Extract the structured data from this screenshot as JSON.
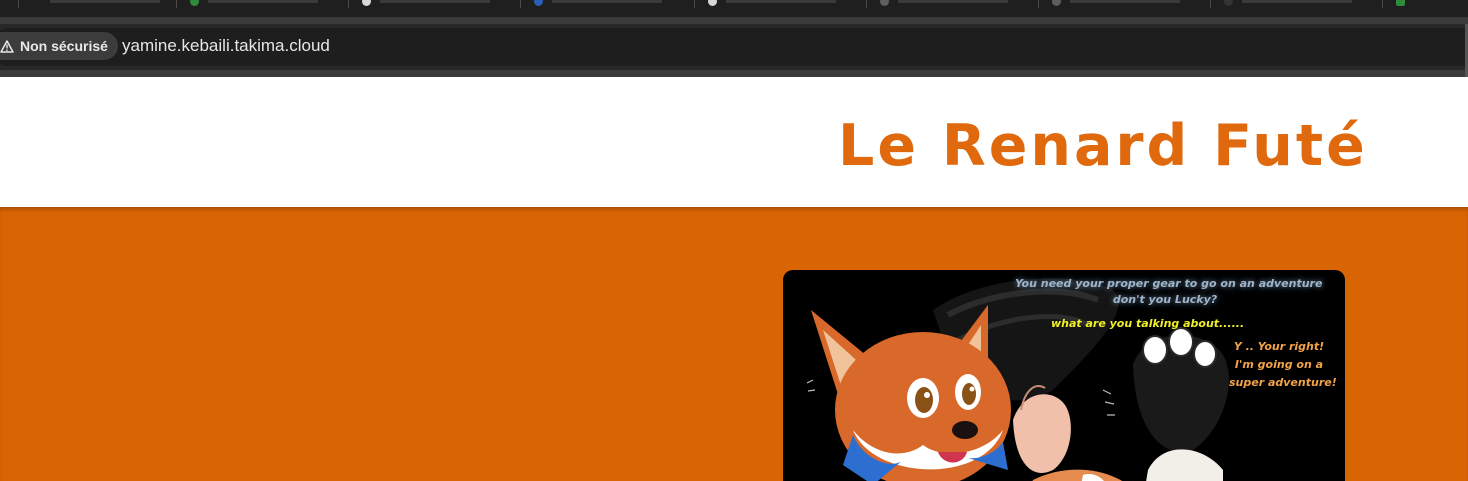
{
  "browser": {
    "security_label": "Non sécurisé",
    "url": "yamine.kebaili.takima.cloud"
  },
  "site": {
    "title": "Le Renard Futé"
  },
  "comic": {
    "line1": "You need your proper gear to go on an adventure",
    "line2": "don't you Lucky?",
    "line3": "what are you talking about......",
    "reply1": "Y .. Your right!",
    "reply2": "I'm going on a",
    "reply3": "super adventure!"
  },
  "colors": {
    "brand_orange": "#d96404",
    "title_orange": "#e0690d"
  }
}
